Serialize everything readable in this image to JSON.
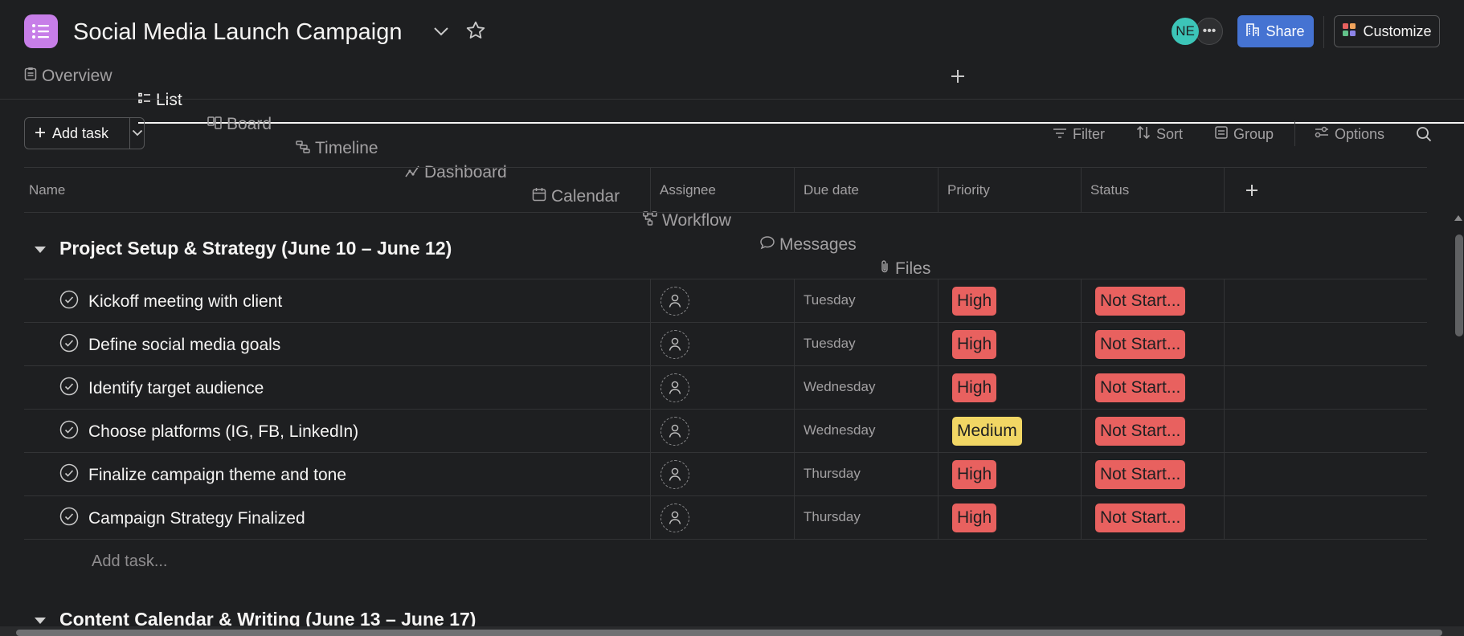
{
  "header": {
    "title": "Social Media Launch Campaign",
    "avatar_initials": "NE",
    "share_label": "Share",
    "customize_label": "Customize"
  },
  "tabs": [
    {
      "label": "Overview",
      "icon": "clipboard-icon"
    },
    {
      "label": "List",
      "icon": "list-icon",
      "active": true
    },
    {
      "label": "Board",
      "icon": "board-icon"
    },
    {
      "label": "Timeline",
      "icon": "timeline-icon"
    },
    {
      "label": "Dashboard",
      "icon": "dashboard-icon"
    },
    {
      "label": "Calendar",
      "icon": "calendar-icon"
    },
    {
      "label": "Workflow",
      "icon": "workflow-icon"
    },
    {
      "label": "Messages",
      "icon": "message-icon"
    },
    {
      "label": "Files",
      "icon": "paperclip-icon"
    }
  ],
  "toolbar": {
    "add_task_label": "Add task",
    "filter_label": "Filter",
    "sort_label": "Sort",
    "group_label": "Group",
    "options_label": "Options"
  },
  "table": {
    "columns": [
      "Name",
      "Assignee",
      "Due date",
      "Priority",
      "Status"
    ],
    "sections": [
      {
        "title": "Project Setup & Strategy (June 10 – June 12)",
        "tasks": [
          {
            "name": "Kickoff meeting with client",
            "due": "Tuesday",
            "priority": "High",
            "status": "Not Start..."
          },
          {
            "name": "Define social media goals",
            "due": "Tuesday",
            "priority": "High",
            "status": "Not Start..."
          },
          {
            "name": "Identify target audience",
            "due": "Wednesday",
            "priority": "High",
            "status": "Not Start..."
          },
          {
            "name": "Choose platforms (IG, FB, LinkedIn)",
            "due": "Wednesday",
            "priority": "Medium",
            "status": "Not Start..."
          },
          {
            "name": "Finalize campaign theme and tone",
            "due": "Thursday",
            "priority": "High",
            "status": "Not Start..."
          },
          {
            "name": "Campaign Strategy Finalized",
            "due": "Thursday",
            "priority": "High",
            "status": "Not Start..."
          }
        ],
        "add_task_label": "Add task..."
      },
      {
        "title": "Content Calendar & Writing (June 13 – June 17)"
      }
    ]
  },
  "colors": {
    "background": "#1e1f21",
    "accent": "#4573d2",
    "high": "#e8615f",
    "medium": "#f1d664",
    "app_icon": "#c77ee8"
  }
}
